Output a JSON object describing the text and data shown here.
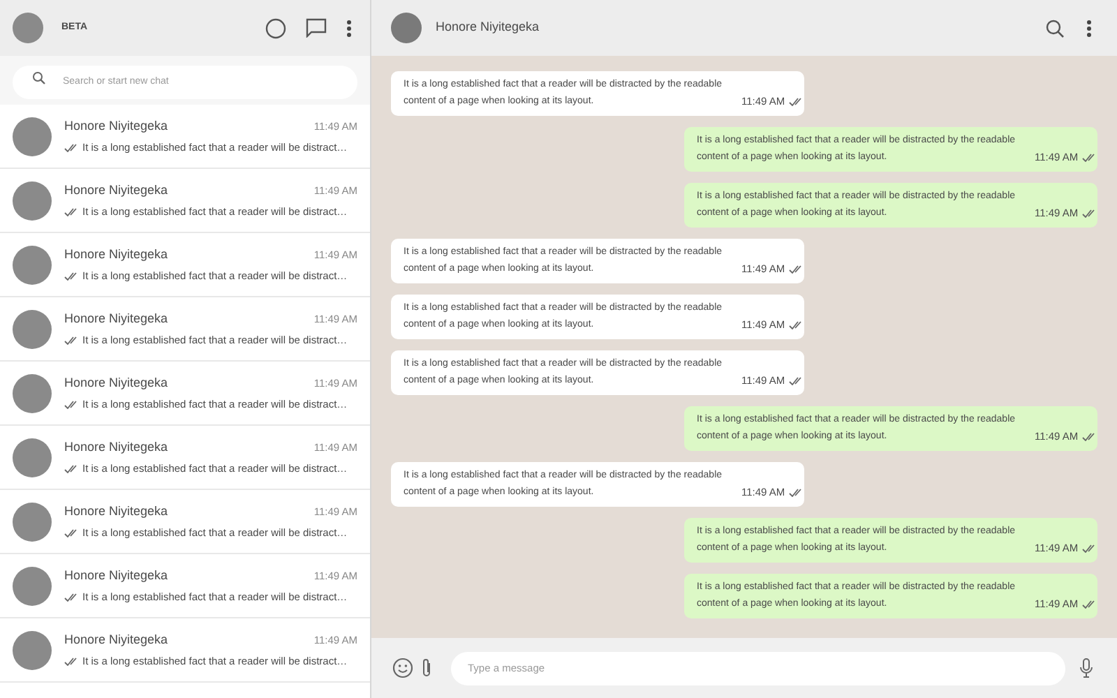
{
  "sidebar": {
    "header": {
      "label": "BETA"
    },
    "search": {
      "placeholder": "Search or start new chat"
    },
    "chats": [
      {
        "name": "Honore Niyitegeka",
        "time": "11:49 AM",
        "preview": "It is a long established fact that a reader will be distract…"
      },
      {
        "name": "Honore Niyitegeka",
        "time": "11:49 AM",
        "preview": "It is a long established fact that a reader will be distract…"
      },
      {
        "name": "Honore Niyitegeka",
        "time": "11:49 AM",
        "preview": "It is a long established fact that a reader will be distract…"
      },
      {
        "name": "Honore Niyitegeka",
        "time": "11:49 AM",
        "preview": "It is a long established fact that a reader will be distract…"
      },
      {
        "name": "Honore Niyitegeka",
        "time": "11:49 AM",
        "preview": "It is a long established fact that a reader will be distract…"
      },
      {
        "name": "Honore Niyitegeka",
        "time": "11:49 AM",
        "preview": "It is a long established fact that a reader will be distract…"
      },
      {
        "name": "Honore Niyitegeka",
        "time": "11:49 AM",
        "preview": "It is a long established fact that a reader will be distract…"
      },
      {
        "name": "Honore Niyitegeka",
        "time": "11:49 AM",
        "preview": "It is a long established fact that a reader will be distract…"
      },
      {
        "name": "Honore Niyitegeka",
        "time": "11:49 AM",
        "preview": "It is a long established fact that a reader will be distract…"
      }
    ]
  },
  "conversation": {
    "contact": "Honore Niyitegeka",
    "messages": [
      {
        "kind": "incoming",
        "text": "It is a long established fact that a reader will be distracted by the readable content of a page when looking at its layout.",
        "time": "11:49 AM"
      },
      {
        "kind": "outgoing",
        "text": "It is a long established fact that a reader will be distracted by the readable content of a page when looking at its layout.",
        "time": "11:49 AM"
      },
      {
        "kind": "outgoing",
        "text": "It is a long established fact that a reader will be distracted by the readable content of a page when looking at its layout.",
        "time": "11:49 AM"
      },
      {
        "kind": "incoming",
        "text": "It is a long established fact that a reader will be distracted by the readable content of a page when looking at its layout.",
        "time": "11:49 AM"
      },
      {
        "kind": "incoming",
        "text": "It is a long established fact that a reader will be distracted by the readable content of a page when looking at its layout.",
        "time": "11:49 AM"
      },
      {
        "kind": "incoming",
        "text": "It is a long established fact that a reader will be distracted by the readable content of a page when looking at its layout.",
        "time": "11:49 AM"
      },
      {
        "kind": "outgoing",
        "text": "It is a long established fact that a reader will be distracted by the readable content of a page when looking at its layout.",
        "time": "11:49 AM"
      },
      {
        "kind": "incoming",
        "text": "It is a long established fact that a reader will be distracted by the readable content of a page when looking at its layout.",
        "time": "11:49 AM"
      },
      {
        "kind": "outgoing",
        "text": "It is a long established fact that a reader will be distracted by the readable content of a page when looking at its layout.",
        "time": "11:49 AM"
      },
      {
        "kind": "outgoing",
        "text": "It is a long established fact that a reader will be distracted by the readable content of a page when looking at its layout.",
        "time": "11:49 AM"
      }
    ],
    "composer": {
      "placeholder": "Type a message"
    }
  }
}
